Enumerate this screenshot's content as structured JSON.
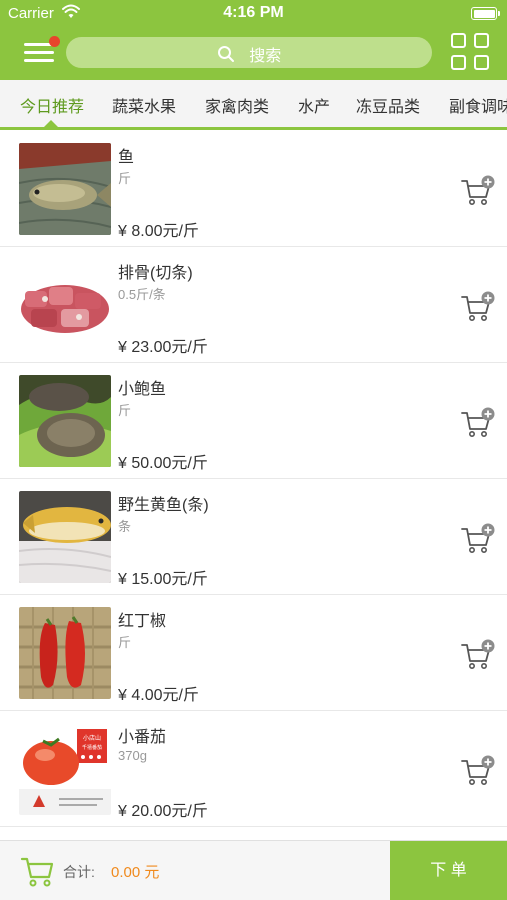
{
  "status_bar": {
    "carrier": "Carrier",
    "time": "4:16 PM"
  },
  "header": {
    "menu_icon": "hamburger-menu-icon",
    "search": {
      "placeholder": "搜索",
      "icon": "search-icon"
    },
    "grid_icon": "grid-menu-icon",
    "accent": "#8cc53f",
    "badge_color": "#e8452c"
  },
  "tabs": [
    {
      "label": "今日推荐",
      "active": true
    },
    {
      "label": "蔬菜水果"
    },
    {
      "label": "家禽肉类"
    },
    {
      "label": "水产"
    },
    {
      "label": "冻豆品类"
    },
    {
      "label": "副食调味"
    }
  ],
  "products": [
    {
      "name": "鱼",
      "spec": "斤",
      "price": "¥ 8.00元/斤"
    },
    {
      "name": "排骨(切条)",
      "spec": "0.5斤/条",
      "price": "¥ 23.00元/斤"
    },
    {
      "name": "小鲍鱼",
      "spec": "斤",
      "price": "¥ 50.00元/斤"
    },
    {
      "name": "野生黄鱼(条)",
      "spec": "条",
      "price": "¥ 15.00元/斤"
    },
    {
      "name": "红丁椒",
      "spec": "斤",
      "price": "¥ 4.00元/斤"
    },
    {
      "name": "小番茄",
      "spec": "370g",
      "price": "¥ 20.00元/斤"
    }
  ],
  "thumb_text": {
    "sign_top": "小店山",
    "sign_sub": "千禧番茄"
  },
  "footer": {
    "total_label": "合计:",
    "total_value": "0.00 元",
    "order_label": "下 单",
    "total_color": "#f08a1d"
  }
}
